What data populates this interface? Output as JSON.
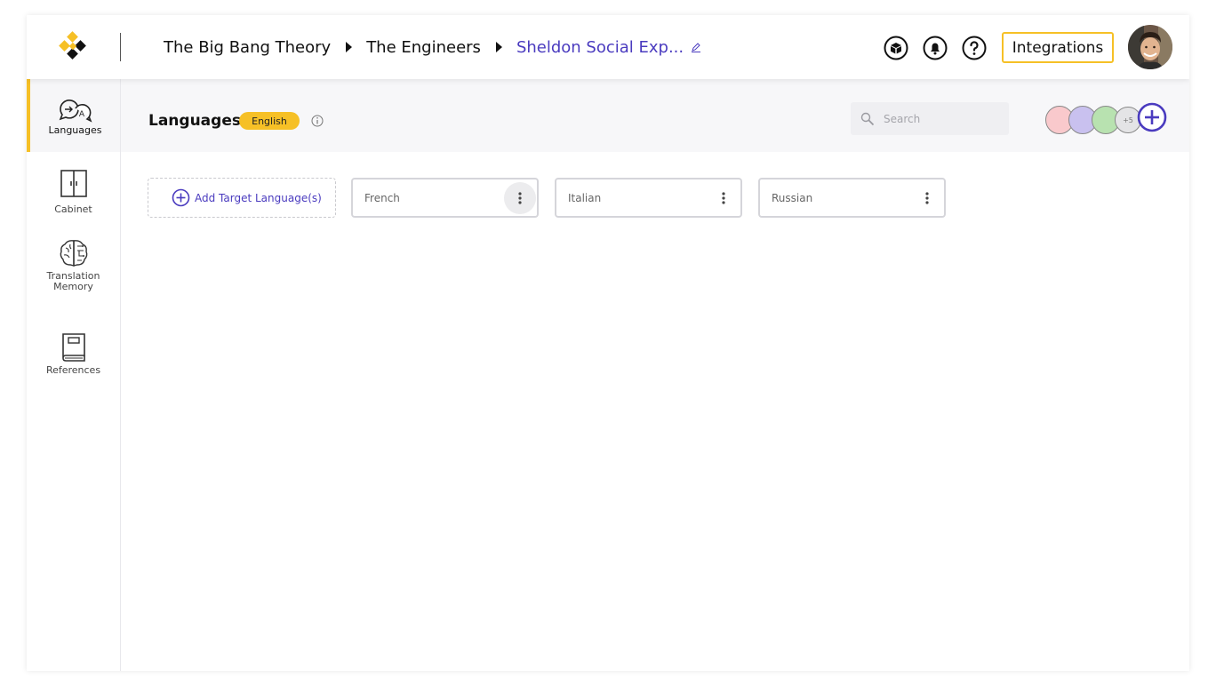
{
  "header": {
    "logo_icon": "brand-logo",
    "breadcrumbs": [
      "The Big Bang Theory",
      "The Engineers",
      "Sheldon Social Exp..."
    ],
    "icons": [
      "box-icon",
      "bell-icon",
      "help-icon"
    ],
    "integrations_label": "Integrations",
    "avatar_icon": "user-avatar"
  },
  "sidebar": {
    "items": [
      {
        "label": "Languages",
        "icon": "languages-icon",
        "active": true
      },
      {
        "label": "Cabinet",
        "icon": "cabinet-icon",
        "active": false
      },
      {
        "label": "Translation\nMemory",
        "icon": "brain-icon",
        "active": false
      },
      {
        "label": "References",
        "icon": "book-icon",
        "active": false
      }
    ]
  },
  "subheader": {
    "title": "Languages",
    "source_language": "English",
    "search_placeholder": "Search",
    "members_more": "+5",
    "member_colors": [
      "#f9c9cc",
      "#c9c1ef",
      "#b8e2b0",
      "#e4e4e6"
    ]
  },
  "content": {
    "add_label": "Add Target Language(s)",
    "languages": [
      "French",
      "Italian",
      "Russian"
    ]
  },
  "colors": {
    "accent_yellow": "#f6c026",
    "accent_purple": "#4a3bbf"
  }
}
